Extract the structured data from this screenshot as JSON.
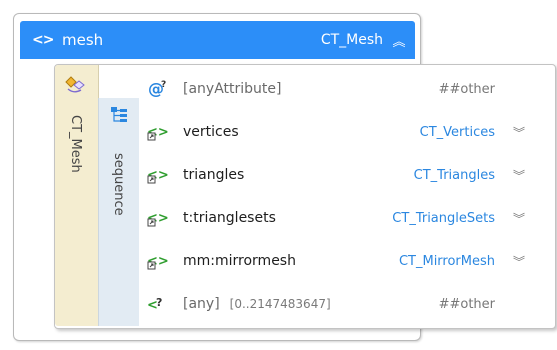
{
  "colors": {
    "header_bg": "#2c8ef8",
    "type_link": "#2b87e0",
    "side_bg": "#f4edd0",
    "seq_bg": "#e2ebf3",
    "element_icon": "#2f9e2f"
  },
  "header": {
    "icon": "element-icon",
    "name": "mesh",
    "type": "CT_Mesh",
    "collapse_glyph": "︽"
  },
  "side_label": "CT_Mesh",
  "compositor_label": "sequence",
  "attributes": [
    {
      "icon": "any-attribute-icon",
      "name": "[anyAttribute]",
      "type": "##other"
    }
  ],
  "elements": [
    {
      "icon": "element-ref-icon",
      "name": "vertices",
      "type": "CT_Vertices",
      "expand_glyph": "︾"
    },
    {
      "icon": "element-ref-icon",
      "name": "triangles",
      "type": "CT_Triangles",
      "expand_glyph": "︾"
    },
    {
      "icon": "element-ref-icon",
      "name": "t:trianglesets",
      "type": "CT_TriangleSets",
      "expand_glyph": "︾"
    },
    {
      "icon": "element-ref-icon",
      "name": "mm:mirrormesh",
      "type": "CT_MirrorMesh",
      "expand_glyph": "︾"
    }
  ],
  "any": {
    "icon": "any-element-icon",
    "name": "[any]",
    "occurs": "[0..2147483647]",
    "type": "##other"
  }
}
